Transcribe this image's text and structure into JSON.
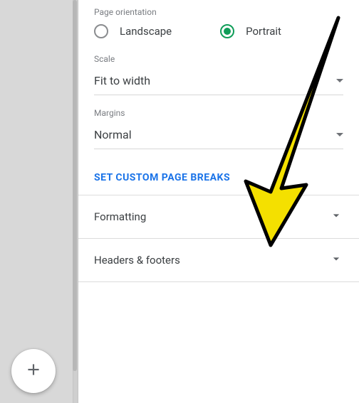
{
  "orientation": {
    "label": "Page orientation",
    "options": {
      "landscape": "Landscape",
      "portrait": "Portrait"
    },
    "selected": "portrait"
  },
  "scale": {
    "label": "Scale",
    "value": "Fit to width"
  },
  "margins": {
    "label": "Margins",
    "value": "Normal"
  },
  "custom_breaks_label": "SET CUSTOM PAGE BREAKS",
  "accordion": {
    "formatting": "Formatting",
    "headers_footers": "Headers & footers"
  },
  "fab_icon_name": "plus"
}
